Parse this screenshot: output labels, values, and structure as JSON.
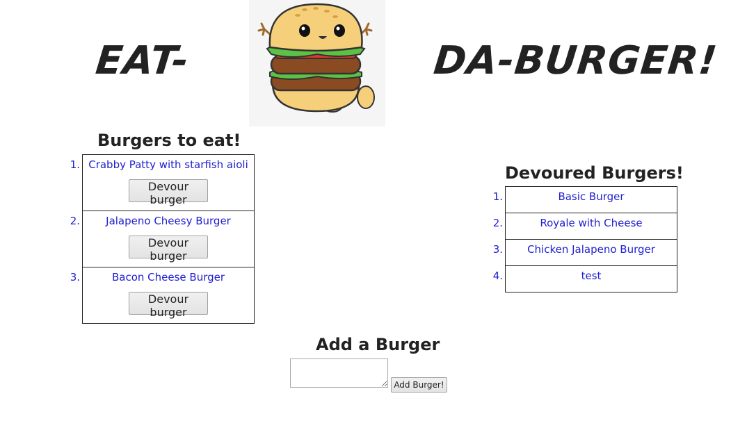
{
  "header": {
    "left_word": "EAT-",
    "right_word": "DA-BURGER!",
    "logo": "cartoon-burger-mascot"
  },
  "eat": {
    "title": "Burgers to eat!",
    "button_label": "Devour burger",
    "items": [
      {
        "num": "1.",
        "name": "Crabby Patty with starfish aioli"
      },
      {
        "num": "2.",
        "name": "Jalapeno Cheesy Burger"
      },
      {
        "num": "3.",
        "name": "Bacon Cheese Burger"
      }
    ]
  },
  "devoured": {
    "title": "Devoured Burgers!",
    "items": [
      {
        "num": "1.",
        "name": "Basic Burger"
      },
      {
        "num": "2.",
        "name": "Royale with Cheese"
      },
      {
        "num": "3.",
        "name": "Chicken Jalapeno Burger"
      },
      {
        "num": "4.",
        "name": "test"
      }
    ]
  },
  "add": {
    "title": "Add a Burger",
    "input_value": "",
    "button_label": "Add Burger!"
  },
  "colors": {
    "link_blue": "#2020d0",
    "text": "#222222"
  }
}
